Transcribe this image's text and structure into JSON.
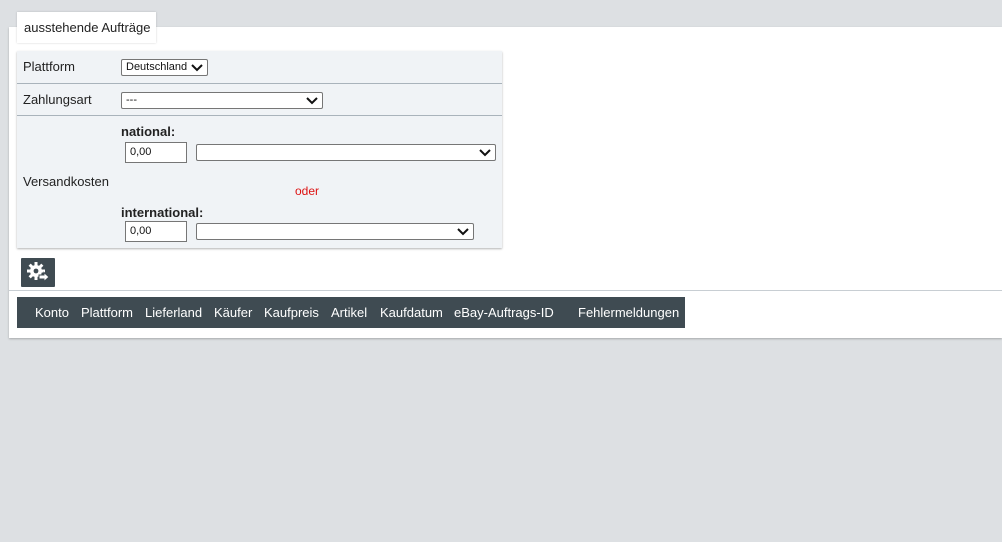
{
  "tab": {
    "label": "ausstehende Aufträge"
  },
  "form": {
    "platform": {
      "label": "Plattform",
      "selected": "Deutschland"
    },
    "payment": {
      "label": "Zahlungsart",
      "selected": "---"
    },
    "shipping": {
      "label": "Versandkosten",
      "national_label": "national:",
      "national_value": "0,00",
      "national_selected": "",
      "or_label": "oder",
      "international_label": "international:",
      "international_value": "0,00",
      "international_selected": ""
    }
  },
  "settings_button": {
    "icon": "gear-arrow-icon"
  },
  "table": {
    "headers": [
      "Konto",
      "Plattform",
      "Lieferland",
      "Käufer",
      "Kaufpreis",
      "Artikel",
      "Kaufdatum",
      "eBay-Auftrags-ID",
      "Fehlermeldungen"
    ]
  },
  "colors": {
    "header_bg": "#3f4b52",
    "accent_red": "#dd1111",
    "form_bg": "#f0f3f6"
  }
}
